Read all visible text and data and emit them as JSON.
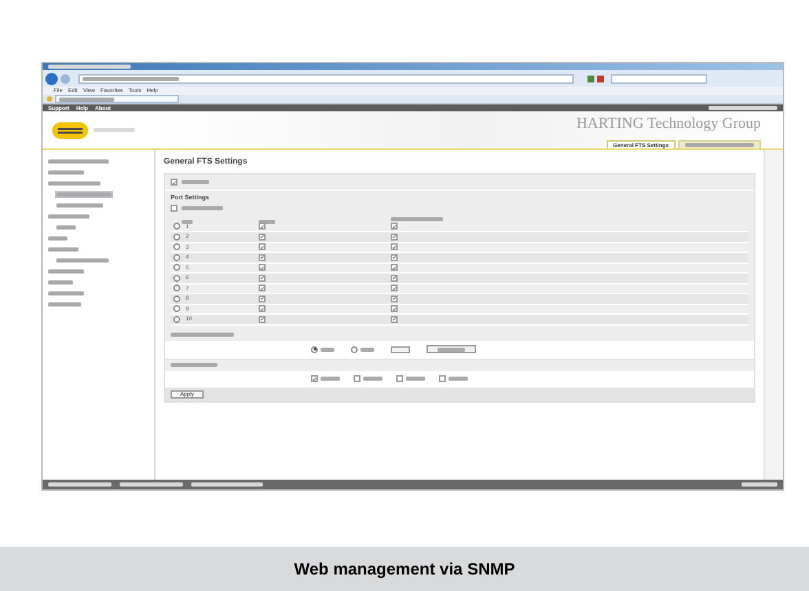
{
  "browser": {
    "menu": [
      "File",
      "Edit",
      "View",
      "Favorites",
      "Tools",
      "Help"
    ]
  },
  "nav": [
    "Support",
    "Help",
    "About"
  ],
  "brand": "HARTING Technology Group",
  "tabs": [
    {
      "label": "General FTS Settings",
      "selected": true
    },
    {
      "selected": false
    }
  ],
  "sidebar": [
    {
      "selected": false
    },
    {
      "selected": false
    },
    {
      "selected": false
    },
    {
      "selected": true
    },
    {
      "selected": false
    },
    {
      "selected": false
    },
    {
      "selected": false
    },
    {
      "selected": false
    },
    {
      "selected": false
    },
    {
      "selected": false
    },
    {
      "selected": false
    },
    {
      "selected": false
    },
    {
      "selected": false
    },
    {
      "selected": false
    }
  ],
  "page": {
    "title": "General FTS Settings",
    "enable": {
      "checked": true
    },
    "section": "Port Settings",
    "select_all": {
      "checked": false
    },
    "rows": [
      {
        "port": "1",
        "selected": false,
        "checked": true
      },
      {
        "port": "2",
        "selected": false,
        "checked": true
      },
      {
        "port": "3",
        "selected": false,
        "checked": true
      },
      {
        "port": "4",
        "selected": false,
        "checked": true
      },
      {
        "port": "5",
        "selected": false,
        "checked": true
      },
      {
        "port": "6",
        "selected": false,
        "checked": true
      },
      {
        "port": "7",
        "selected": false,
        "checked": true
      },
      {
        "port": "8",
        "selected": false,
        "checked": true
      },
      {
        "port": "9",
        "selected": false,
        "checked": true
      },
      {
        "port": "10",
        "selected": false,
        "checked": true
      }
    ],
    "mode": [
      {
        "selected": true
      },
      {
        "selected": false
      }
    ],
    "flags": [
      {
        "checked": true
      },
      {
        "checked": false
      },
      {
        "checked": false
      },
      {
        "checked": false
      }
    ],
    "apply": "Apply"
  },
  "caption": "Web management via SNMP"
}
